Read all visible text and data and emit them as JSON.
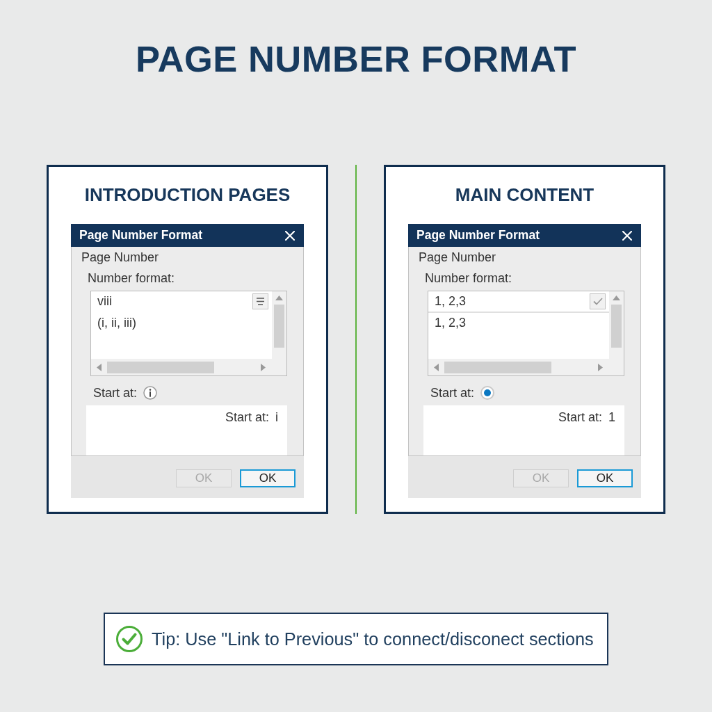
{
  "title": "PAGE NUMBER FORMAT",
  "panels": [
    {
      "heading": "INTRODUCTION PAGES",
      "dialog": {
        "title": "Page Number Format",
        "section_label": "Page Number",
        "format_label": "Number format:",
        "format_list": [
          {
            "text": "viii",
            "selected": false
          },
          {
            "text": "(i, ii, iii)",
            "selected": false
          }
        ],
        "start_label": "Start at:",
        "start_control": {
          "kind": "info"
        },
        "start_value_label": "Start at:",
        "start_value": "i",
        "buttons": [
          {
            "label": "OK",
            "disabled": true
          },
          {
            "label": "OK",
            "disabled": false
          }
        ]
      }
    },
    {
      "heading": "MAIN CONTENT",
      "dialog": {
        "title": "Page Number Format",
        "section_label": "Page Number",
        "format_label": "Number format:",
        "format_list": [
          {
            "text": "1, 2,3",
            "selected": true
          },
          {
            "text": "1, 2,3",
            "selected": false
          }
        ],
        "start_label": "Start at:",
        "start_control": {
          "kind": "radio",
          "selected": true
        },
        "start_value_label": "Start at:",
        "start_value": "1",
        "buttons": [
          {
            "label": "OK",
            "disabled": true
          },
          {
            "label": "OK",
            "disabled": false
          }
        ]
      }
    }
  ],
  "tip": {
    "text": "Tip: Use \"Link to Previous\" to connect/disconect sections"
  }
}
